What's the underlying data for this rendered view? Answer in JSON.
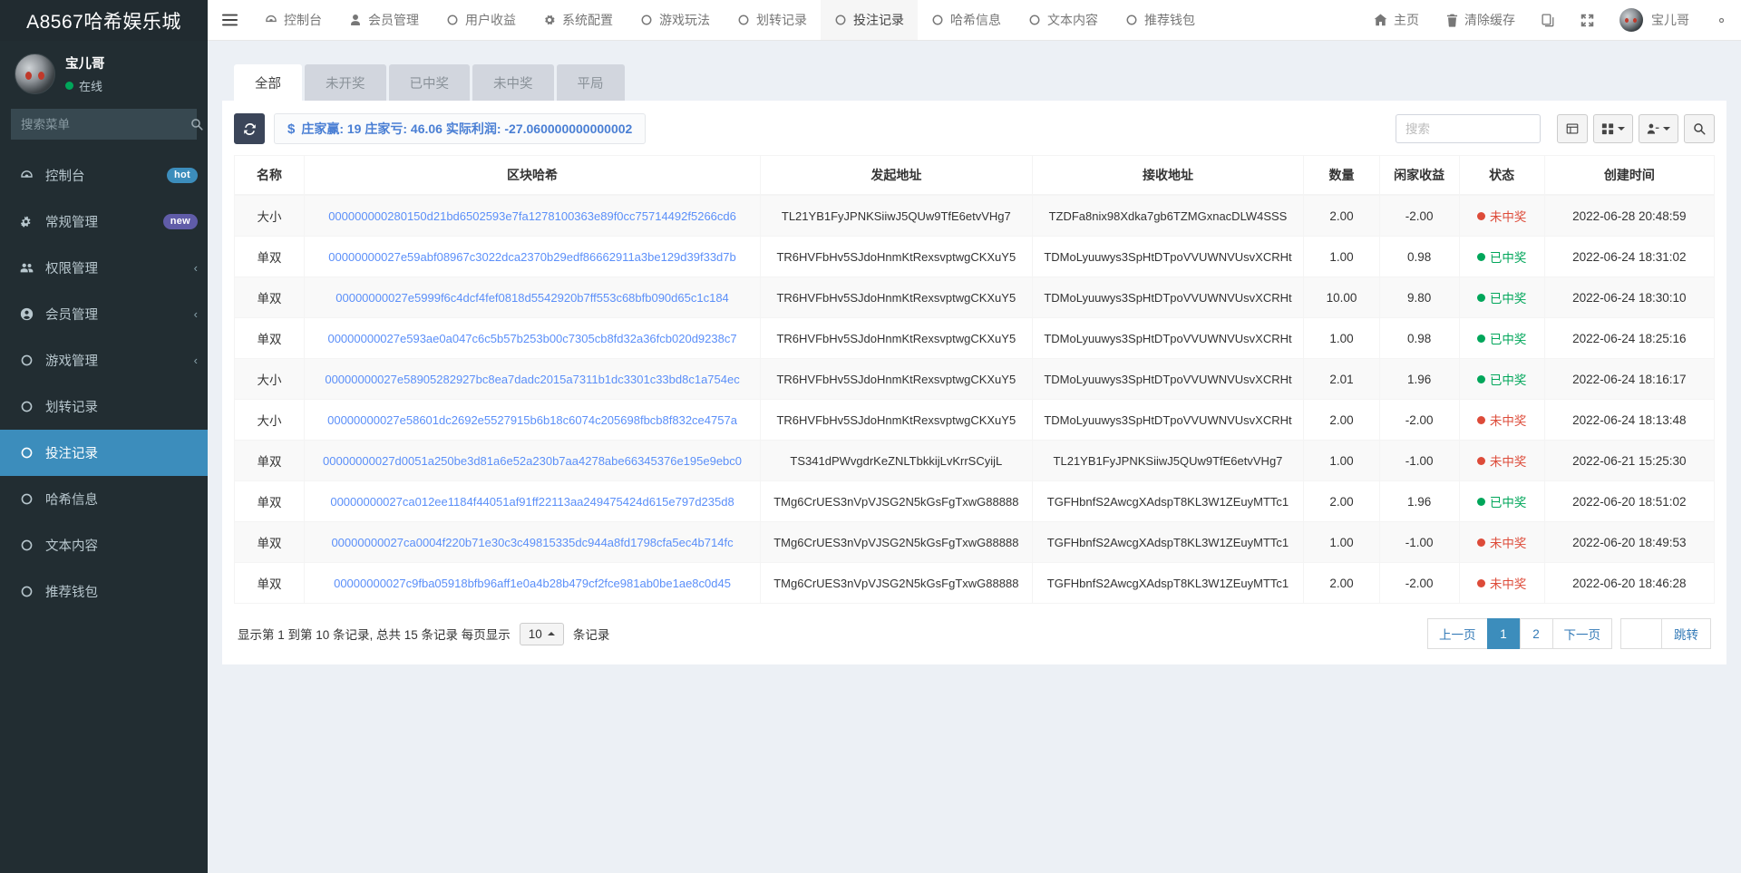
{
  "sidebar": {
    "brand": "A8567哈希娱乐城",
    "user": {
      "name": "宝儿哥",
      "status": "在线"
    },
    "search_placeholder": "搜索菜单",
    "items": [
      {
        "label": "控制台",
        "icon": "dashboard-icon",
        "badge": "hot",
        "badge_type": "hot",
        "chevron": false,
        "active": false
      },
      {
        "label": "常规管理",
        "icon": "cogs-icon",
        "badge": "new",
        "badge_type": "new",
        "chevron": false,
        "active": false
      },
      {
        "label": "权限管理",
        "icon": "users-icon",
        "badge": "",
        "badge_type": "",
        "chevron": true,
        "active": false
      },
      {
        "label": "会员管理",
        "icon": "user-circle-icon",
        "badge": "",
        "badge_type": "",
        "chevron": true,
        "active": false
      },
      {
        "label": "游戏管理",
        "icon": "circle-icon",
        "badge": "",
        "badge_type": "",
        "chevron": true,
        "active": false
      },
      {
        "label": "划转记录",
        "icon": "circle-icon",
        "badge": "",
        "badge_type": "",
        "chevron": false,
        "active": false
      },
      {
        "label": "投注记录",
        "icon": "circle-icon",
        "badge": "",
        "badge_type": "",
        "chevron": false,
        "active": true
      },
      {
        "label": "哈希信息",
        "icon": "circle-icon",
        "badge": "",
        "badge_type": "",
        "chevron": false,
        "active": false
      },
      {
        "label": "文本内容",
        "icon": "circle-icon",
        "badge": "",
        "badge_type": "",
        "chevron": false,
        "active": false
      },
      {
        "label": "推荐钱包",
        "icon": "circle-icon",
        "badge": "",
        "badge_type": "",
        "chevron": false,
        "active": false
      }
    ]
  },
  "navbar": {
    "hamburger_icon": "hamburger-icon",
    "links": [
      {
        "label": "控制台",
        "icon": "dashboard-icon",
        "active": false
      },
      {
        "label": "会员管理",
        "icon": "user-icon",
        "active": false
      },
      {
        "label": "用户收益",
        "icon": "circle-icon",
        "active": false
      },
      {
        "label": "系统配置",
        "icon": "gear-icon",
        "active": false
      },
      {
        "label": "游戏玩法",
        "icon": "circle-icon",
        "active": false
      },
      {
        "label": "划转记录",
        "icon": "circle-icon",
        "active": false
      },
      {
        "label": "投注记录",
        "icon": "circle-icon",
        "active": true
      },
      {
        "label": "哈希信息",
        "icon": "circle-icon",
        "active": false
      },
      {
        "label": "文本内容",
        "icon": "circle-icon",
        "active": false
      },
      {
        "label": "推荐钱包",
        "icon": "circle-icon",
        "active": false
      }
    ],
    "home_label": "主页",
    "clear_cache_label": "清除缓存",
    "user_name": "宝儿哥"
  },
  "tabs": [
    {
      "label": "全部",
      "active": true
    },
    {
      "label": "未开奖",
      "active": false
    },
    {
      "label": "已中奖",
      "active": false
    },
    {
      "label": "未中奖",
      "active": false
    },
    {
      "label": "平局",
      "active": false
    }
  ],
  "toolbar": {
    "refresh_icon": "refresh-icon",
    "stats_text": "庄家赢: 19 庄家亏: 46.06 实际利润: -27.060000000000002",
    "search_placeholder": "搜索",
    "search_value": ""
  },
  "table": {
    "columns": [
      "名称",
      "区块哈希",
      "发起地址",
      "接收地址",
      "数量",
      "闲家收益",
      "状态",
      "创建时间"
    ],
    "rows": [
      {
        "name": "大小",
        "hash": "000000000280150d21bd6502593e7fa1278100363e89f0cc75714492f5266cd6",
        "from": "TL21YB1FyJPNKSiiwJ5QUw9TfE6etvVHg7",
        "to": "TZDFa8nix98Xdka7gb6TZMGxnacDLW4SSS",
        "amount": "2.00",
        "profit": "-2.00",
        "status": "未中奖",
        "status_type": "lose",
        "time": "2022-06-28 20:48:59"
      },
      {
        "name": "单双",
        "hash": "00000000027e59abf08967c3022dca2370b29edf86662911a3be129d39f33d7b",
        "from": "TR6HVFbHv5SJdoHnmKtRexsvptwgCKXuY5",
        "to": "TDMoLyuuwys3SpHtDTpoVVUWNVUsvXCRHt",
        "amount": "1.00",
        "profit": "0.98",
        "status": "已中奖",
        "status_type": "win",
        "time": "2022-06-24 18:31:02"
      },
      {
        "name": "单双",
        "hash": "00000000027e5999f6c4dcf4fef0818d5542920b7ff553c68bfb090d65c1c184",
        "from": "TR6HVFbHv5SJdoHnmKtRexsvptwgCKXuY5",
        "to": "TDMoLyuuwys3SpHtDTpoVVUWNVUsvXCRHt",
        "amount": "10.00",
        "profit": "9.80",
        "status": "已中奖",
        "status_type": "win",
        "time": "2022-06-24 18:30:10"
      },
      {
        "name": "单双",
        "hash": "00000000027e593ae0a047c6c5b57b253b00c7305cb8fd32a36fcb020d9238c7",
        "from": "TR6HVFbHv5SJdoHnmKtRexsvptwgCKXuY5",
        "to": "TDMoLyuuwys3SpHtDTpoVVUWNVUsvXCRHt",
        "amount": "1.00",
        "profit": "0.98",
        "status": "已中奖",
        "status_type": "win",
        "time": "2022-06-24 18:25:16"
      },
      {
        "name": "大小",
        "hash": "00000000027e58905282927bc8ea7dadc2015a7311b1dc3301c33bd8c1a754ec",
        "from": "TR6HVFbHv5SJdoHnmKtRexsvptwgCKXuY5",
        "to": "TDMoLyuuwys3SpHtDTpoVVUWNVUsvXCRHt",
        "amount": "2.01",
        "profit": "1.96",
        "status": "已中奖",
        "status_type": "win",
        "time": "2022-06-24 18:16:17"
      },
      {
        "name": "大小",
        "hash": "00000000027e58601dc2692e5527915b6b18c6074c205698fbcb8f832ce4757a",
        "from": "TR6HVFbHv5SJdoHnmKtRexsvptwgCKXuY5",
        "to": "TDMoLyuuwys3SpHtDTpoVVUWNVUsvXCRHt",
        "amount": "2.00",
        "profit": "-2.00",
        "status": "未中奖",
        "status_type": "lose",
        "time": "2022-06-24 18:13:48"
      },
      {
        "name": "单双",
        "hash": "00000000027d0051a250be3d81a6e52a230b7aa4278abe66345376e195e9ebc0",
        "from": "TS341dPWvgdrKeZNLTbkkijLvKrrSCyijL",
        "to": "TL21YB1FyJPNKSiiwJ5QUw9TfE6etvVHg7",
        "amount": "1.00",
        "profit": "-1.00",
        "status": "未中奖",
        "status_type": "lose",
        "time": "2022-06-21 15:25:30"
      },
      {
        "name": "单双",
        "hash": "00000000027ca012ee1184f44051af91ff22113aa249475424d615e797d235d8",
        "from": "TMg6CrUES3nVpVJSG2N5kGsFgTxwG88888",
        "to": "TGFHbnfS2AwcgXAdspT8KL3W1ZEuyMTTc1",
        "amount": "2.00",
        "profit": "1.96",
        "status": "已中奖",
        "status_type": "win",
        "time": "2022-06-20 18:51:02"
      },
      {
        "name": "单双",
        "hash": "00000000027ca0004f220b71e30c3c49815335dc944a8fd1798cfa5ec4b714fc",
        "from": "TMg6CrUES3nVpVJSG2N5kGsFgTxwG88888",
        "to": "TGFHbnfS2AwcgXAdspT8KL3W1ZEuyMTTc1",
        "amount": "1.00",
        "profit": "-1.00",
        "status": "未中奖",
        "status_type": "lose",
        "time": "2022-06-20 18:49:53"
      },
      {
        "name": "单双",
        "hash": "00000000027c9fba05918bfb96aff1e0a4b28b479cf2fce981ab0be1ae8c0d45",
        "from": "TMg6CrUES3nVpVJSG2N5kGsFgTxwG88888",
        "to": "TGFHbnfS2AwcgXAdspT8KL3W1ZEuyMTTc1",
        "amount": "2.00",
        "profit": "-2.00",
        "status": "未中奖",
        "status_type": "lose",
        "time": "2022-06-20 18:46:28"
      }
    ]
  },
  "pagination": {
    "info_prefix": "显示第 1 到第 10 条记录, 总共 15 条记录 每页显示",
    "page_size": "10",
    "info_suffix": "条记录",
    "prev_label": "上一页",
    "pages": [
      "1",
      "2"
    ],
    "current_page": "1",
    "next_label": "下一页",
    "jump_value": "",
    "jump_label": "跳转"
  },
  "colors": {
    "sidebar_bg": "#222d32",
    "accent": "#3c8dbc",
    "badge_new": "#605ca8",
    "win": "#00a65a",
    "lose": "#dd4b39",
    "link": "#5b8ff9"
  }
}
